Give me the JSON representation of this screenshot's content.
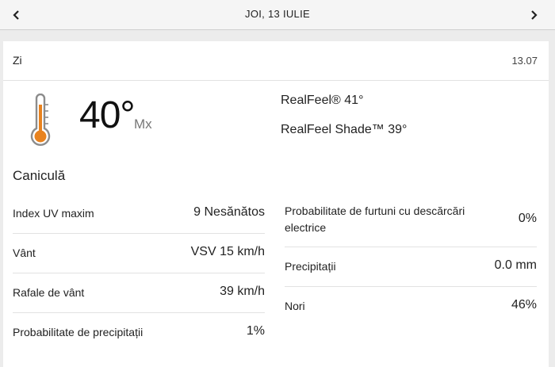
{
  "header": {
    "date": "JOI, 13 IULIE",
    "prev_icon": "chevron-left-icon",
    "next_icon": "chevron-right-icon"
  },
  "card": {
    "period_label": "Zi",
    "period_date": "13.07",
    "weather_icon": "thermometer-hot-icon",
    "temperature": "40°",
    "temperature_unit": "Mx",
    "realfeel": "RealFeel® 41°",
    "realfeel_shade": "RealFeel Shade™ 39°",
    "phrase": "Caniculă",
    "details_left": [
      {
        "label": "Index UV maxim",
        "value": "9 Nesănătos"
      },
      {
        "label": "Vânt",
        "value": "VSV 15 km/h"
      },
      {
        "label": "Rafale de vânt",
        "value": "39 km/h"
      },
      {
        "label": "Probabilitate de precipitații",
        "value": "1%"
      }
    ],
    "details_right": [
      {
        "label": "Probabilitate de furtuni cu descărcări electrice",
        "value": "0%"
      },
      {
        "label": "Precipitații",
        "value": "0.0 mm"
      },
      {
        "label": "Nori",
        "value": "46%"
      }
    ]
  },
  "colors": {
    "accent_orange": "#e8821e",
    "icon_gray": "#8c8c8c"
  }
}
